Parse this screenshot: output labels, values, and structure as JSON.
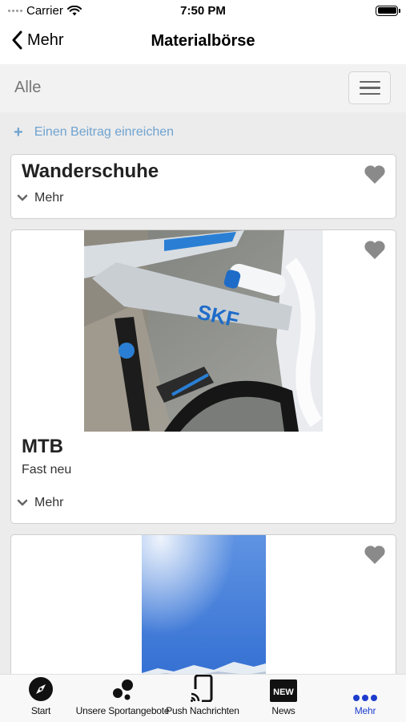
{
  "status_bar": {
    "carrier": "Carrier",
    "time": "7:50 PM"
  },
  "nav": {
    "back_label": "Mehr",
    "title": "Materialbörse"
  },
  "filter": {
    "label": "Alle"
  },
  "add_post": {
    "label": "Einen Beitrag einreichen"
  },
  "listings": [
    {
      "title": "Wanderschuhe",
      "description": "",
      "more_label": "Mehr"
    },
    {
      "title": "MTB",
      "description": "Fast neu",
      "more_label": "Mehr"
    },
    {
      "title": "",
      "description": "",
      "more_label": ""
    }
  ],
  "tab_bar": {
    "items": [
      {
        "label": "Start",
        "icon": "compass-icon"
      },
      {
        "label": "Unsere Sportangebote",
        "icon": "dots-cluster-icon"
      },
      {
        "label": "Push Nachrichten",
        "icon": "phone-cast-icon"
      },
      {
        "label": "News",
        "icon": "new-badge-icon",
        "badge_text": "NEW"
      },
      {
        "label": "Mehr",
        "icon": "more-dots-icon",
        "active": true
      }
    ]
  },
  "colors": {
    "accent": "#1d3ccc",
    "link": "#6fa3d0",
    "heart": "#8a8a8a",
    "background": "#ececec"
  }
}
